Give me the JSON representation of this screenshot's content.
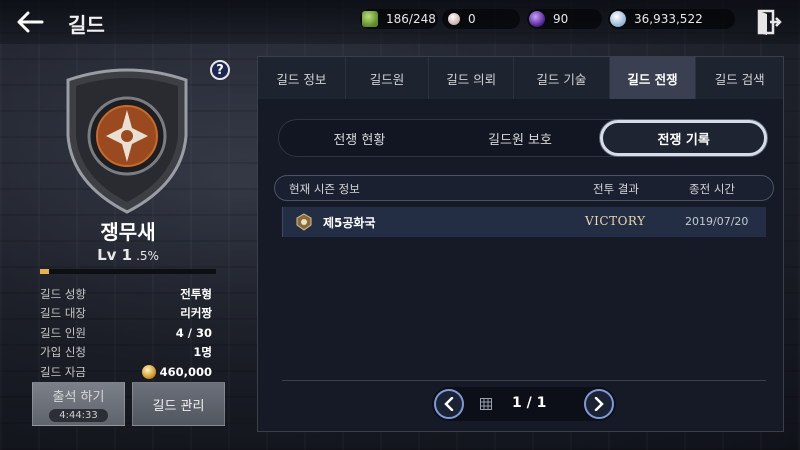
{
  "header": {
    "title": "길드",
    "currencies": [
      {
        "icon": "stamina-icon",
        "value": "186/248",
        "color": "#6d9a3a"
      },
      {
        "icon": "pearl-icon",
        "value": "0",
        "color": "#d8c8c0"
      },
      {
        "icon": "dark-orb-icon",
        "value": "90",
        "color": "#6a3bb0"
      },
      {
        "icon": "silver-coin-icon",
        "value": "36,933,522",
        "color": "#b8d0e8"
      }
    ]
  },
  "guild": {
    "name": "쟁무새",
    "level": "Lv 1",
    "exp_percent": ".5%",
    "exp_fraction": 0.05,
    "stats": [
      {
        "label": "길드 성향",
        "value": "전투형"
      },
      {
        "label": "길드 대장",
        "value": "리커짱"
      },
      {
        "label": "길드 인원",
        "value": "4 / 30"
      },
      {
        "label": "가입 신청",
        "value": "1명"
      },
      {
        "label": "길드 자금",
        "value": "460,000"
      }
    ]
  },
  "buttons": {
    "attend_label": "출석 하기",
    "attend_timer": "4:44:33",
    "manage_label": "길드 관리"
  },
  "tabs": [
    "길드 정보",
    "길드원",
    "길드 의뢰",
    "길드 기술",
    "길드 전쟁",
    "길드 검색"
  ],
  "active_tab": "길드 전쟁",
  "segments": [
    "전쟁 현황",
    "길드원 보호",
    "전쟁 기록"
  ],
  "active_segment": "전쟁 기록",
  "table": {
    "columns": [
      "현재 시즌 정보",
      "전투 결과",
      "종전 시간"
    ],
    "rows": [
      {
        "name": "제5공화국",
        "result": "VICTORY",
        "date": "2019/07/20"
      }
    ]
  },
  "pager": {
    "text": "1 / 1"
  },
  "colors": {
    "accent": "#e8b24a",
    "active_tab_bg": "#3a4052",
    "panel_bg": "#151a26"
  }
}
